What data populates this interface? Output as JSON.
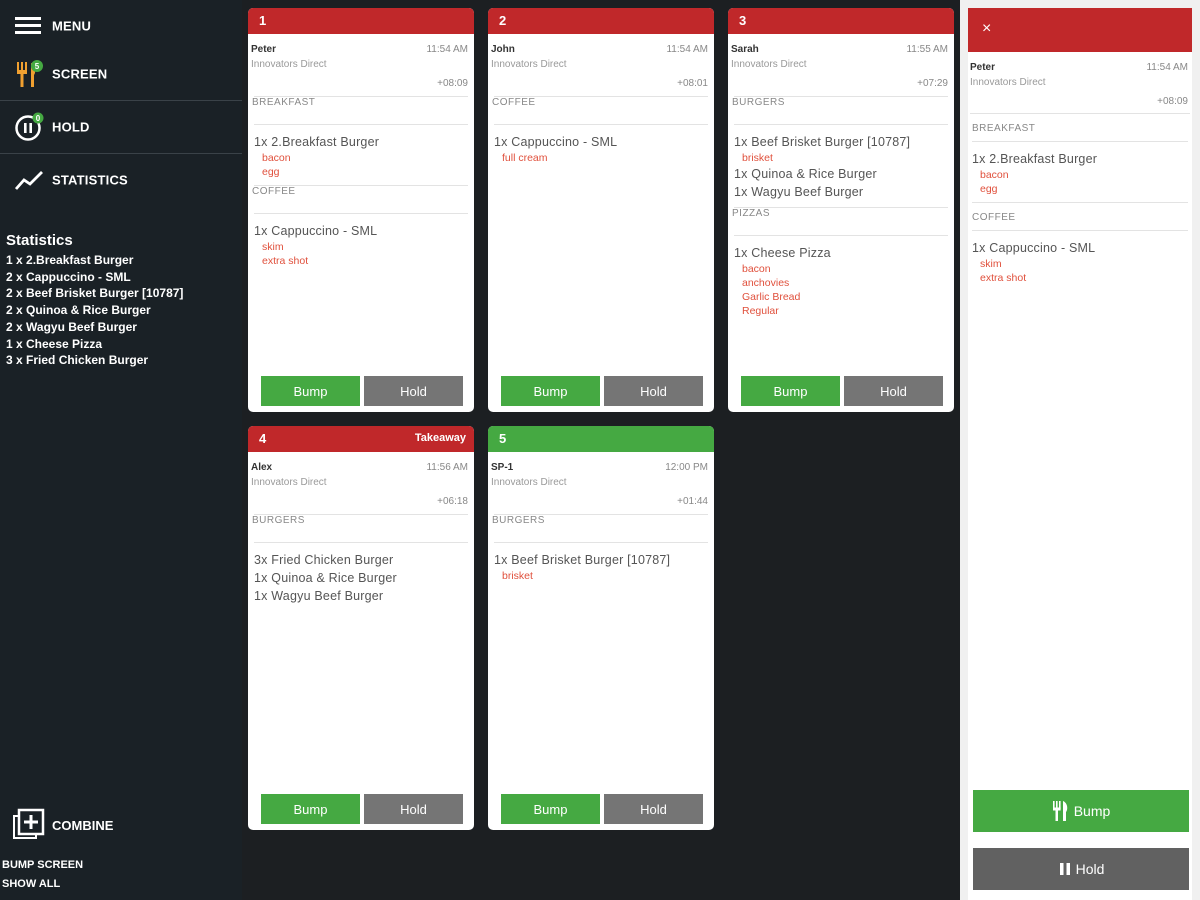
{
  "sidebar": {
    "menu_label": "MENU",
    "screen_label": "SCREEN",
    "screen_badge": "5",
    "hold_label": "HOLD",
    "hold_badge": "0",
    "statistics_label": "STATISTICS",
    "combine_label": "COMBINE",
    "bump_screen_label": "BUMP SCREEN",
    "show_all_label": "SHOW ALL"
  },
  "statistics": {
    "title": "Statistics",
    "lines": [
      "1 x 2.Breakfast Burger",
      "2 x Cappuccino - SML",
      "2 x Beef Brisket Burger [10787]",
      "2 x Quinoa & Rice Burger",
      "2 x Wagyu Beef Burger",
      "1 x Cheese Pizza",
      "3 x Fried Chicken Burger"
    ]
  },
  "tickets": [
    {
      "number": "1",
      "tag": "",
      "name": "Peter",
      "time": "11:54 AM",
      "company": "Innovators Direct",
      "elapsed": "+08:09",
      "sections": [
        {
          "category": "BREAKFAST",
          "items": [
            {
              "text": "1x 2.Breakfast Burger",
              "mods": [
                "bacon",
                "egg"
              ]
            }
          ]
        },
        {
          "category": "COFFEE",
          "items": [
            {
              "text": "1x Cappuccino - SML",
              "mods": [
                "skim",
                "extra shot"
              ]
            }
          ]
        }
      ],
      "bump_label": "Bump",
      "hold_label": "Hold"
    },
    {
      "number": "2",
      "tag": "",
      "name": "John",
      "time": "11:54 AM",
      "company": "Innovators Direct",
      "elapsed": "+08:01",
      "sections": [
        {
          "category": "COFFEE",
          "items": [
            {
              "text": "1x Cappuccino - SML",
              "mods": [
                "full cream"
              ]
            }
          ]
        }
      ],
      "bump_label": "Bump",
      "hold_label": "Hold"
    },
    {
      "number": "3",
      "tag": "",
      "name": "Sarah",
      "time": "11:55 AM",
      "company": "Innovators Direct",
      "elapsed": "+07:29",
      "sections": [
        {
          "category": "BURGERS",
          "items": [
            {
              "text": "1x Beef Brisket Burger [10787]",
              "mods": [
                "brisket"
              ]
            },
            {
              "text": "1x Quinoa & Rice Burger",
              "mods": []
            },
            {
              "text": "1x Wagyu Beef Burger",
              "mods": []
            }
          ]
        },
        {
          "category": "PIZZAS",
          "items": [
            {
              "text": "1x Cheese Pizza",
              "mods": [
                "bacon",
                "anchovies",
                "Garlic Bread",
                "Regular"
              ]
            }
          ]
        }
      ],
      "bump_label": "Bump",
      "hold_label": "Hold"
    },
    {
      "number": "4",
      "tag": "Takeaway",
      "name": "Alex",
      "time": "11:56 AM",
      "company": "Innovators Direct",
      "elapsed": "+06:18",
      "sections": [
        {
          "category": "BURGERS",
          "items": [
            {
              "text": "3x Fried Chicken Burger",
              "mods": []
            },
            {
              "text": "1x Quinoa & Rice Burger",
              "mods": []
            },
            {
              "text": "1x Wagyu Beef Burger",
              "mods": []
            }
          ]
        }
      ],
      "bump_label": "Bump",
      "hold_label": "Hold"
    },
    {
      "number": "5",
      "tag": "",
      "name": "SP-1",
      "time": "12:00 PM",
      "company": "Innovators Direct",
      "elapsed": "+01:44",
      "sections": [
        {
          "category": "BURGERS",
          "items": [
            {
              "text": "1x Beef Brisket Burger [10787]",
              "mods": [
                "brisket"
              ]
            }
          ]
        }
      ],
      "bump_label": "Bump",
      "hold_label": "Hold"
    }
  ],
  "detail": {
    "close_label": "×",
    "name": "Peter",
    "time": "11:54 AM",
    "company": "Innovators Direct",
    "elapsed": "+08:09",
    "sections": [
      {
        "category": "BREAKFAST",
        "items": [
          {
            "text": "1x 2.Breakfast Burger",
            "mods": [
              "bacon",
              "egg"
            ]
          }
        ]
      },
      {
        "category": "COFFEE",
        "items": [
          {
            "text": "1x Cappuccino - SML",
            "mods": [
              "skim",
              "extra shot"
            ]
          }
        ]
      }
    ],
    "bump_label": "Bump",
    "hold_label": "Hold"
  },
  "colors": {
    "header_red": "#c0282a",
    "header_green": "#45a942",
    "bump_green": "#45a942",
    "hold_grey": "#757575",
    "modifier_red": "#e0503c",
    "sidebar_bg": "#1a2126",
    "badge_green": "#45a942",
    "fork_orange": "#f0a030"
  },
  "icons": [
    "hamburger-icon",
    "fork-knife-icon",
    "pause-icon",
    "trend-line-icon",
    "combine-plus-icon",
    "close-icon"
  ]
}
